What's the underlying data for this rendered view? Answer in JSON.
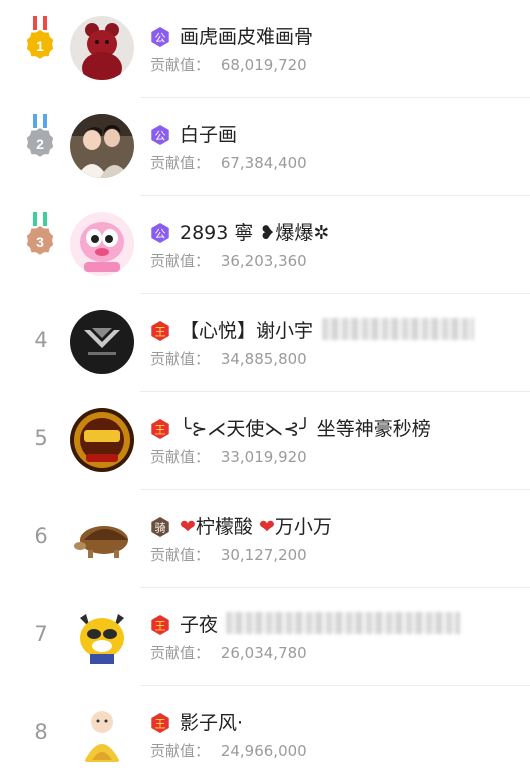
{
  "contribution_label": "贡献值",
  "contribution_sep": "：",
  "entries": [
    {
      "rank": "1",
      "badge": "公",
      "name": "画虎画皮难画骨",
      "contribution": "68,019,720"
    },
    {
      "rank": "2",
      "badge": "公",
      "name": "白子画",
      "contribution": "67,384,400"
    },
    {
      "rank": "3",
      "badge": "公",
      "name": "2893 寧 ❥爆爆✲",
      "contribution": "36,203,360"
    },
    {
      "rank": "4",
      "badge": "王",
      "name": "【心悦】谢小宇",
      "contribution": "34,885,800"
    },
    {
      "rank": "5",
      "badge": "王",
      "name": "╰⊱⋌天使⋋⊰╯ 坐等神豪秒榜",
      "contribution": "33,019,920"
    },
    {
      "rank": "6",
      "badge": "骑",
      "name_parts": [
        "❤",
        "柠檬酸",
        "❤",
        "万小万"
      ],
      "contribution": "30,127,200"
    },
    {
      "rank": "7",
      "badge": "王",
      "name": "子夜",
      "contribution": "26,034,780"
    },
    {
      "rank": "8",
      "badge": "王",
      "name": "影子风·",
      "contribution": "24,966,000"
    }
  ],
  "colors": {
    "gold": "#f5b800",
    "silver": "#a7abb0",
    "bronze": "#d49a7a",
    "badge_purple": "#8a5cf0",
    "badge_red": "#e8332a",
    "badge_dark": "#6b4f3c"
  }
}
